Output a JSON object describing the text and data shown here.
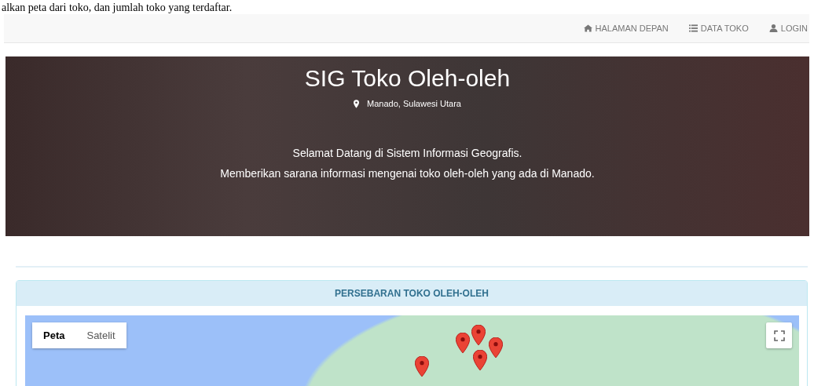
{
  "intro_text": "alkan peta dari toko, dan jumlah toko yang terdaftar.",
  "navbar": {
    "items": [
      {
        "label": "HALAMAN DEPAN"
      },
      {
        "label": "DATA TOKO"
      },
      {
        "label": "LOGIN"
      }
    ]
  },
  "hero": {
    "title": "SIG Toko Oleh-oleh",
    "location": "Manado, Sulawesi Utara",
    "lines": [
      "Selamat Datang di Sistem Informasi Geografis.",
      "Memberikan sarana informasi mengenai toko oleh-oleh yang ada di Manado."
    ]
  },
  "panel": {
    "heading": "PERSEBARAN TOKO OLEH-OLEH",
    "map": {
      "map_types": [
        {
          "label": "Peta",
          "selected": true
        },
        {
          "label": "Satelit",
          "selected": false
        }
      ]
    }
  }
}
